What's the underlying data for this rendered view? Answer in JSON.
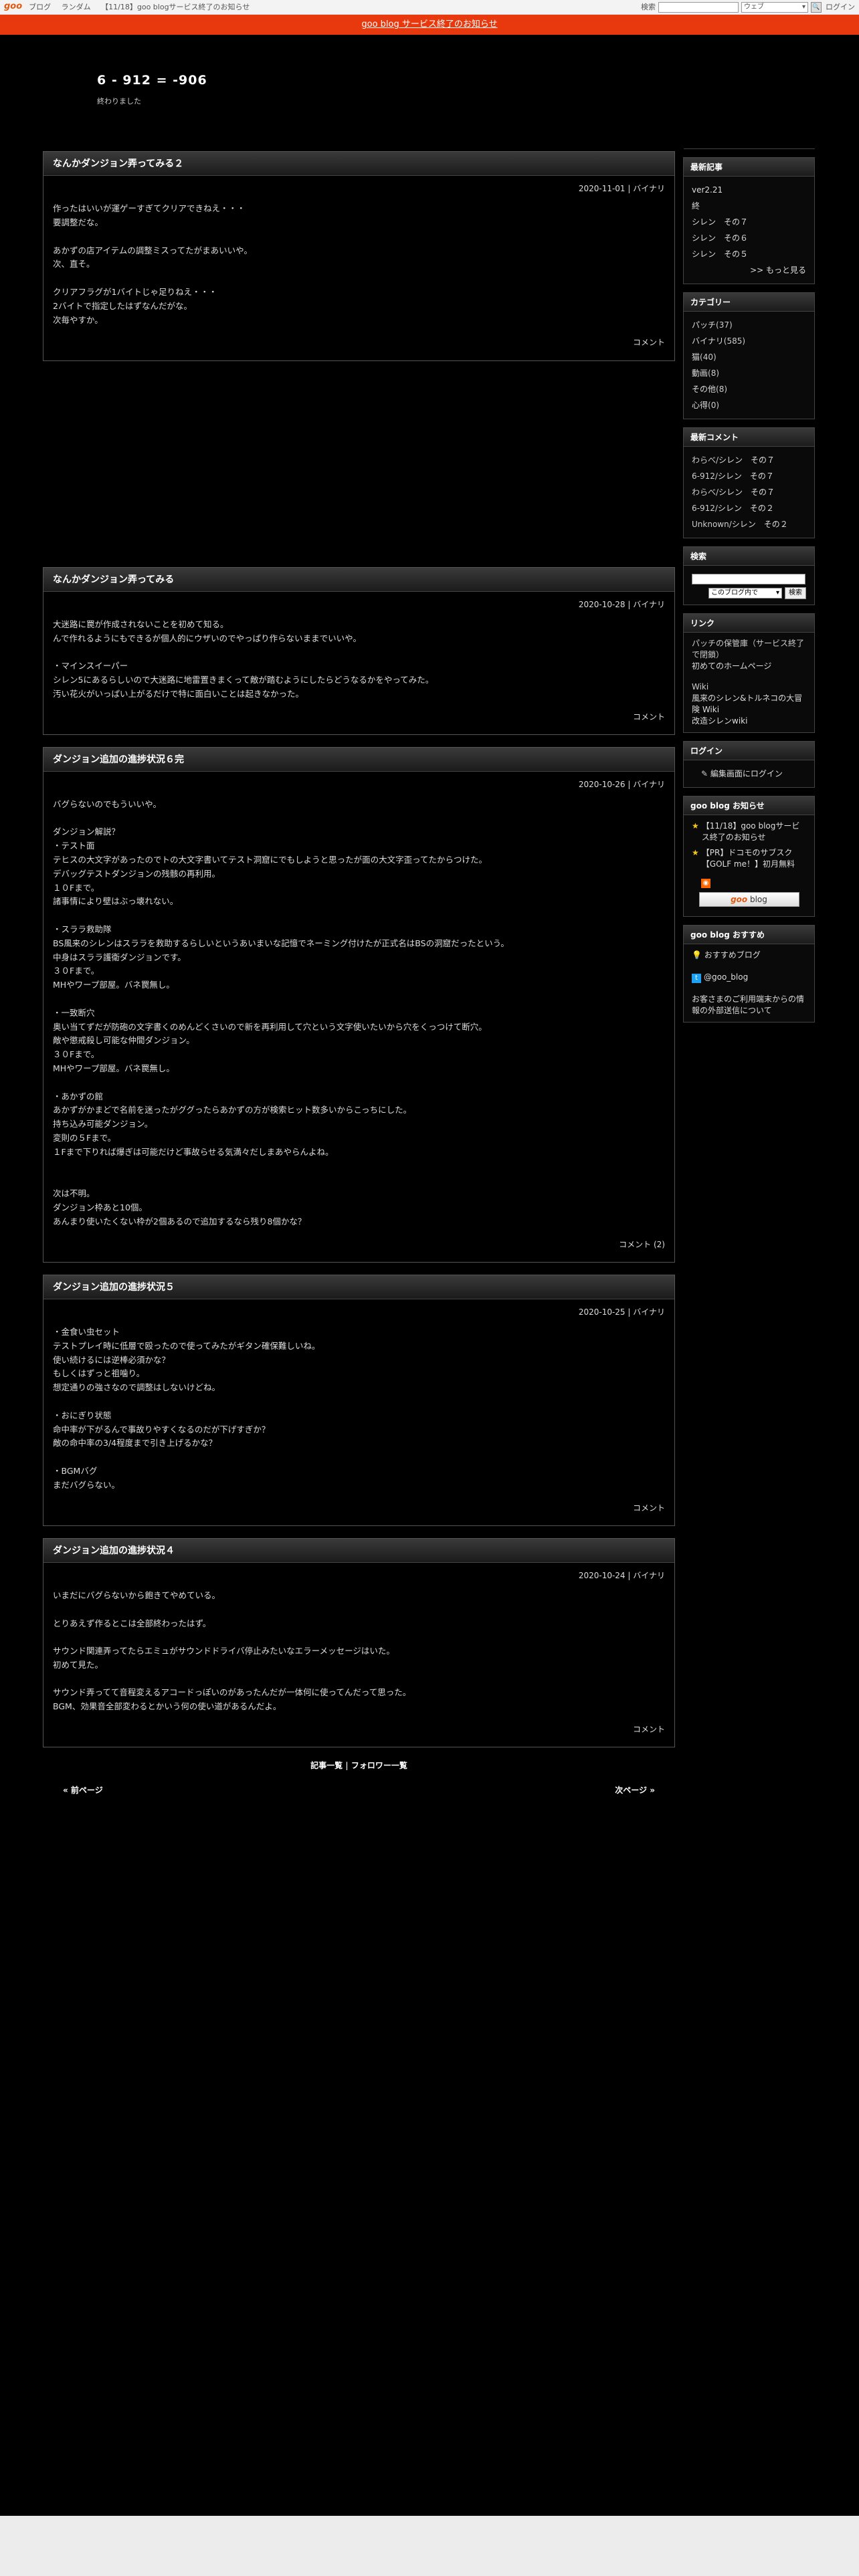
{
  "topbar": {
    "logo": "goo",
    "nav": [
      "ブログ",
      "ランダム",
      "【11/18】goo blogサービス終了のお知らせ"
    ],
    "search_label": "検索",
    "search_scope": "ウェブ",
    "login": "ログイン"
  },
  "notice": "goo blog サービス終了のお知らせ",
  "blog": {
    "title": "6 - 912 = -906",
    "description": "終わりました"
  },
  "entries": [
    {
      "title": "なんかダンジョン弄ってみる２",
      "date": "2020-11-01 | バイナリ",
      "body": "作ったはいいが運ゲーすぎてクリアできねえ・・・\n要調整だな。\n\nあかずの店アイテムの調整ミスってたがまあいいや。\n次、直そ。\n\nクリアフラグが1バイトじゃ足りねえ・・・\n2バイトで指定したはずなんだがな。\n次毎やすか。",
      "footer": "コメント"
    },
    {
      "title": "なんかダンジョン弄ってみる",
      "date": "2020-10-28 | バイナリ",
      "body": "大迷路に罠が作成されないことを初めて知る。\nんで作れるようにもできるが個人的にウザいのでやっぱり作らないままでいいや。\n\n・マインスイーパー\nシレン5にあるらしいので大迷路に地雷置きまくって敵が踏むようにしたらどうなるかをやってみた。\n汚い花火がいっぱい上がるだけで特に面白いことは起きなかった。",
      "footer": "コメント"
    },
    {
      "title": "ダンジョン追加の進捗状況６完",
      "date": "2020-10-26 | バイナリ",
      "body": "バグらないのでもういいや。\n\nダンジョン解説？\n・テスト面\nテヒスの大文字があったのでトの大文字書いてテスト洞窟にでもしようと思ったが面の大文字歪ってたからつけた。\nデバッグテストダンジョンの残骸の再利用。\n１０Fまで。\n諸事情により壁はぶっ壊れない。\n\n・スララ救助隊\nBS風来のシレンはスララを救助するらしいというあいまいな記憶でネーミング付けたが正式名はBSの洞窟だったという。\n中身はスララ護衛ダンジョンです。\n３０Fまで。\nMHやワープ部屋。バネ罠無し。\n\n・一致断穴\n奥い当てずだが防砲の文字書くのめんどくさいので新を再利用して穴という文字使いたいから穴をくっつけて断穴。\n敵や懲戒殺し可能な仲間ダンジョン。\n３０Fまで。\nMHやワープ部屋。バネ罠無し。\n\n・あかずの館\nあかずがかまどで名前を迷ったがググったらあかずの方が検索ヒット数多いからこっちにした。\n持ち込み可能ダンジョン。\n変則の５Fまで。\n１Fまで下りれば爆ぎは可能だけど事故らせる気満々だしまあやらんよね。\n\n\n次は不明。\nダンジョン枠あと10個。\nあんまり使いたくない枠が2個あるので追加するなら残り8個かな？",
      "footer": "コメント (2)"
    },
    {
      "title": "ダンジョン追加の進捗状況５",
      "date": "2020-10-25 | バイナリ",
      "body": "・金食い虫セット\nテストプレイ時に低層で殴ったので使ってみたがギタン確保難しいね。\n使い続けるには逆棒必須かな？\nもしくはずっと祖噛り。\n想定通りの強さなので調整はしないけどね。\n\n・おにぎり状態\n命中率が下がるんで事故りやすくなるのだが下げすぎか？\n敵の命中率の3/4程度まで引き上げるかな？\n\n・BGMバグ\nまだバグらない。",
      "footer": "コメント"
    },
    {
      "title": "ダンジョン追加の進捗状況４",
      "date": "2020-10-24 | バイナリ",
      "body": "いまだにバグらないから飽きてやめている。\n\nとりあえず作るとこは全部終わったはず。\n\nサウンド関連弄ってたらエミュがサウンドドライバ停止みたいなエラーメッセージはいた。\n初めて見た。\n\nサウンド弄ってて音程変えるアコードっぽいのがあったんだが一体何に使ってんだって思った。\nBGM、効果音全部変わるとかいう何の使い道があるんだよ。",
      "footer": "コメント"
    }
  ],
  "bottom_links": [
    "記事一覧",
    "フォロワー一覧"
  ],
  "pager": {
    "prev": "« 前ページ",
    "next": "次ページ »"
  },
  "sidebar": {
    "recent": {
      "title": "最新記事",
      "items": [
        "ver2.21",
        "終",
        "シレン　その７",
        "シレン　その６",
        "シレン　その５"
      ],
      "more": ">> もっと見る"
    },
    "category": {
      "title": "カテゴリー",
      "items": [
        {
          "name": "パッチ",
          "count": "(37)"
        },
        {
          "name": "バイナリ",
          "count": "(585)"
        },
        {
          "name": "猫",
          "count": "(40)"
        },
        {
          "name": "動画",
          "count": "(8)"
        },
        {
          "name": "その他",
          "count": "(8)"
        },
        {
          "name": "心得",
          "count": "(0)"
        }
      ]
    },
    "comments": {
      "title": "最新コメント",
      "items": [
        {
          "who": "わらべ/",
          "post": "シレン　その７"
        },
        {
          "who": "6-912/",
          "post": "シレン　その７"
        },
        {
          "who": "わらべ/",
          "post": "シレン　その７"
        },
        {
          "who": "6-912/",
          "post": "シレン　その２"
        },
        {
          "who": "Unknown/",
          "post": "シレン　その２"
        }
      ]
    },
    "search": {
      "title": "検索",
      "scope": "このブログ内で",
      "button": "検索"
    },
    "links": {
      "title": "リンク",
      "text": "パッチの保管庫（サービス終了で閉鎖）",
      "home": "初めてのホームページ",
      "wiki_label": "Wiki",
      "wiki1": "風来のシレン&トルネコの大冒険 Wiki",
      "wiki2": "改造シレンwiki"
    },
    "login": {
      "title": "ログイン",
      "link": "編集画面にログイン"
    },
    "goo_news": {
      "title": "goo blog お知らせ",
      "items": [
        "【11/18】goo blogサービス終了のお知らせ",
        "【PR】ドコモのサブスク【GOLF me！】初月無料"
      ],
      "button_brand": "goo",
      "button_text": "blog"
    },
    "recommend": {
      "title": "goo blog おすすめ",
      "item": "おすすめブログ",
      "twitter": "@goo_blog",
      "privacy": "お客さまのご利用端末からの情報の外部送信について"
    }
  }
}
